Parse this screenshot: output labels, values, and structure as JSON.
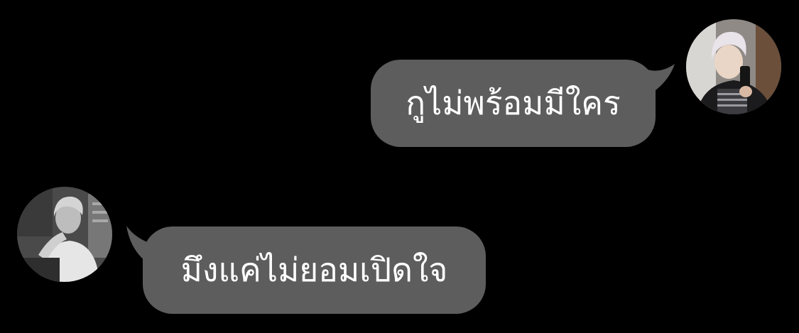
{
  "conversation": {
    "messages": [
      {
        "direction": "outgoing",
        "text": "กูไม่พร้อมมีใคร"
      },
      {
        "direction": "incoming",
        "sender": "",
        "text": "มึงแค่ไม่ยอมเปิดใจ"
      }
    ]
  },
  "theme": {
    "background": "#000000",
    "bubble_color": "#5d5d5d",
    "text_color": "#ffffff"
  }
}
